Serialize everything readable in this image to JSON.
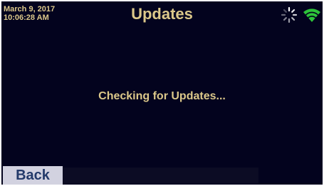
{
  "header": {
    "date": "March 9, 2017",
    "time": "10:06:28 AM",
    "title": "Updates",
    "activity_icon": "spinner-icon",
    "network_icon": "wifi-icon"
  },
  "main": {
    "status_message": "Checking for Updates..."
  },
  "footer": {
    "back_label": "Back"
  },
  "colors": {
    "background": "#03031e",
    "text_accent": "#dcc88a",
    "wifi": "#2ec43a",
    "button_bg": "#d2d2e0",
    "button_text": "#233a6a"
  }
}
